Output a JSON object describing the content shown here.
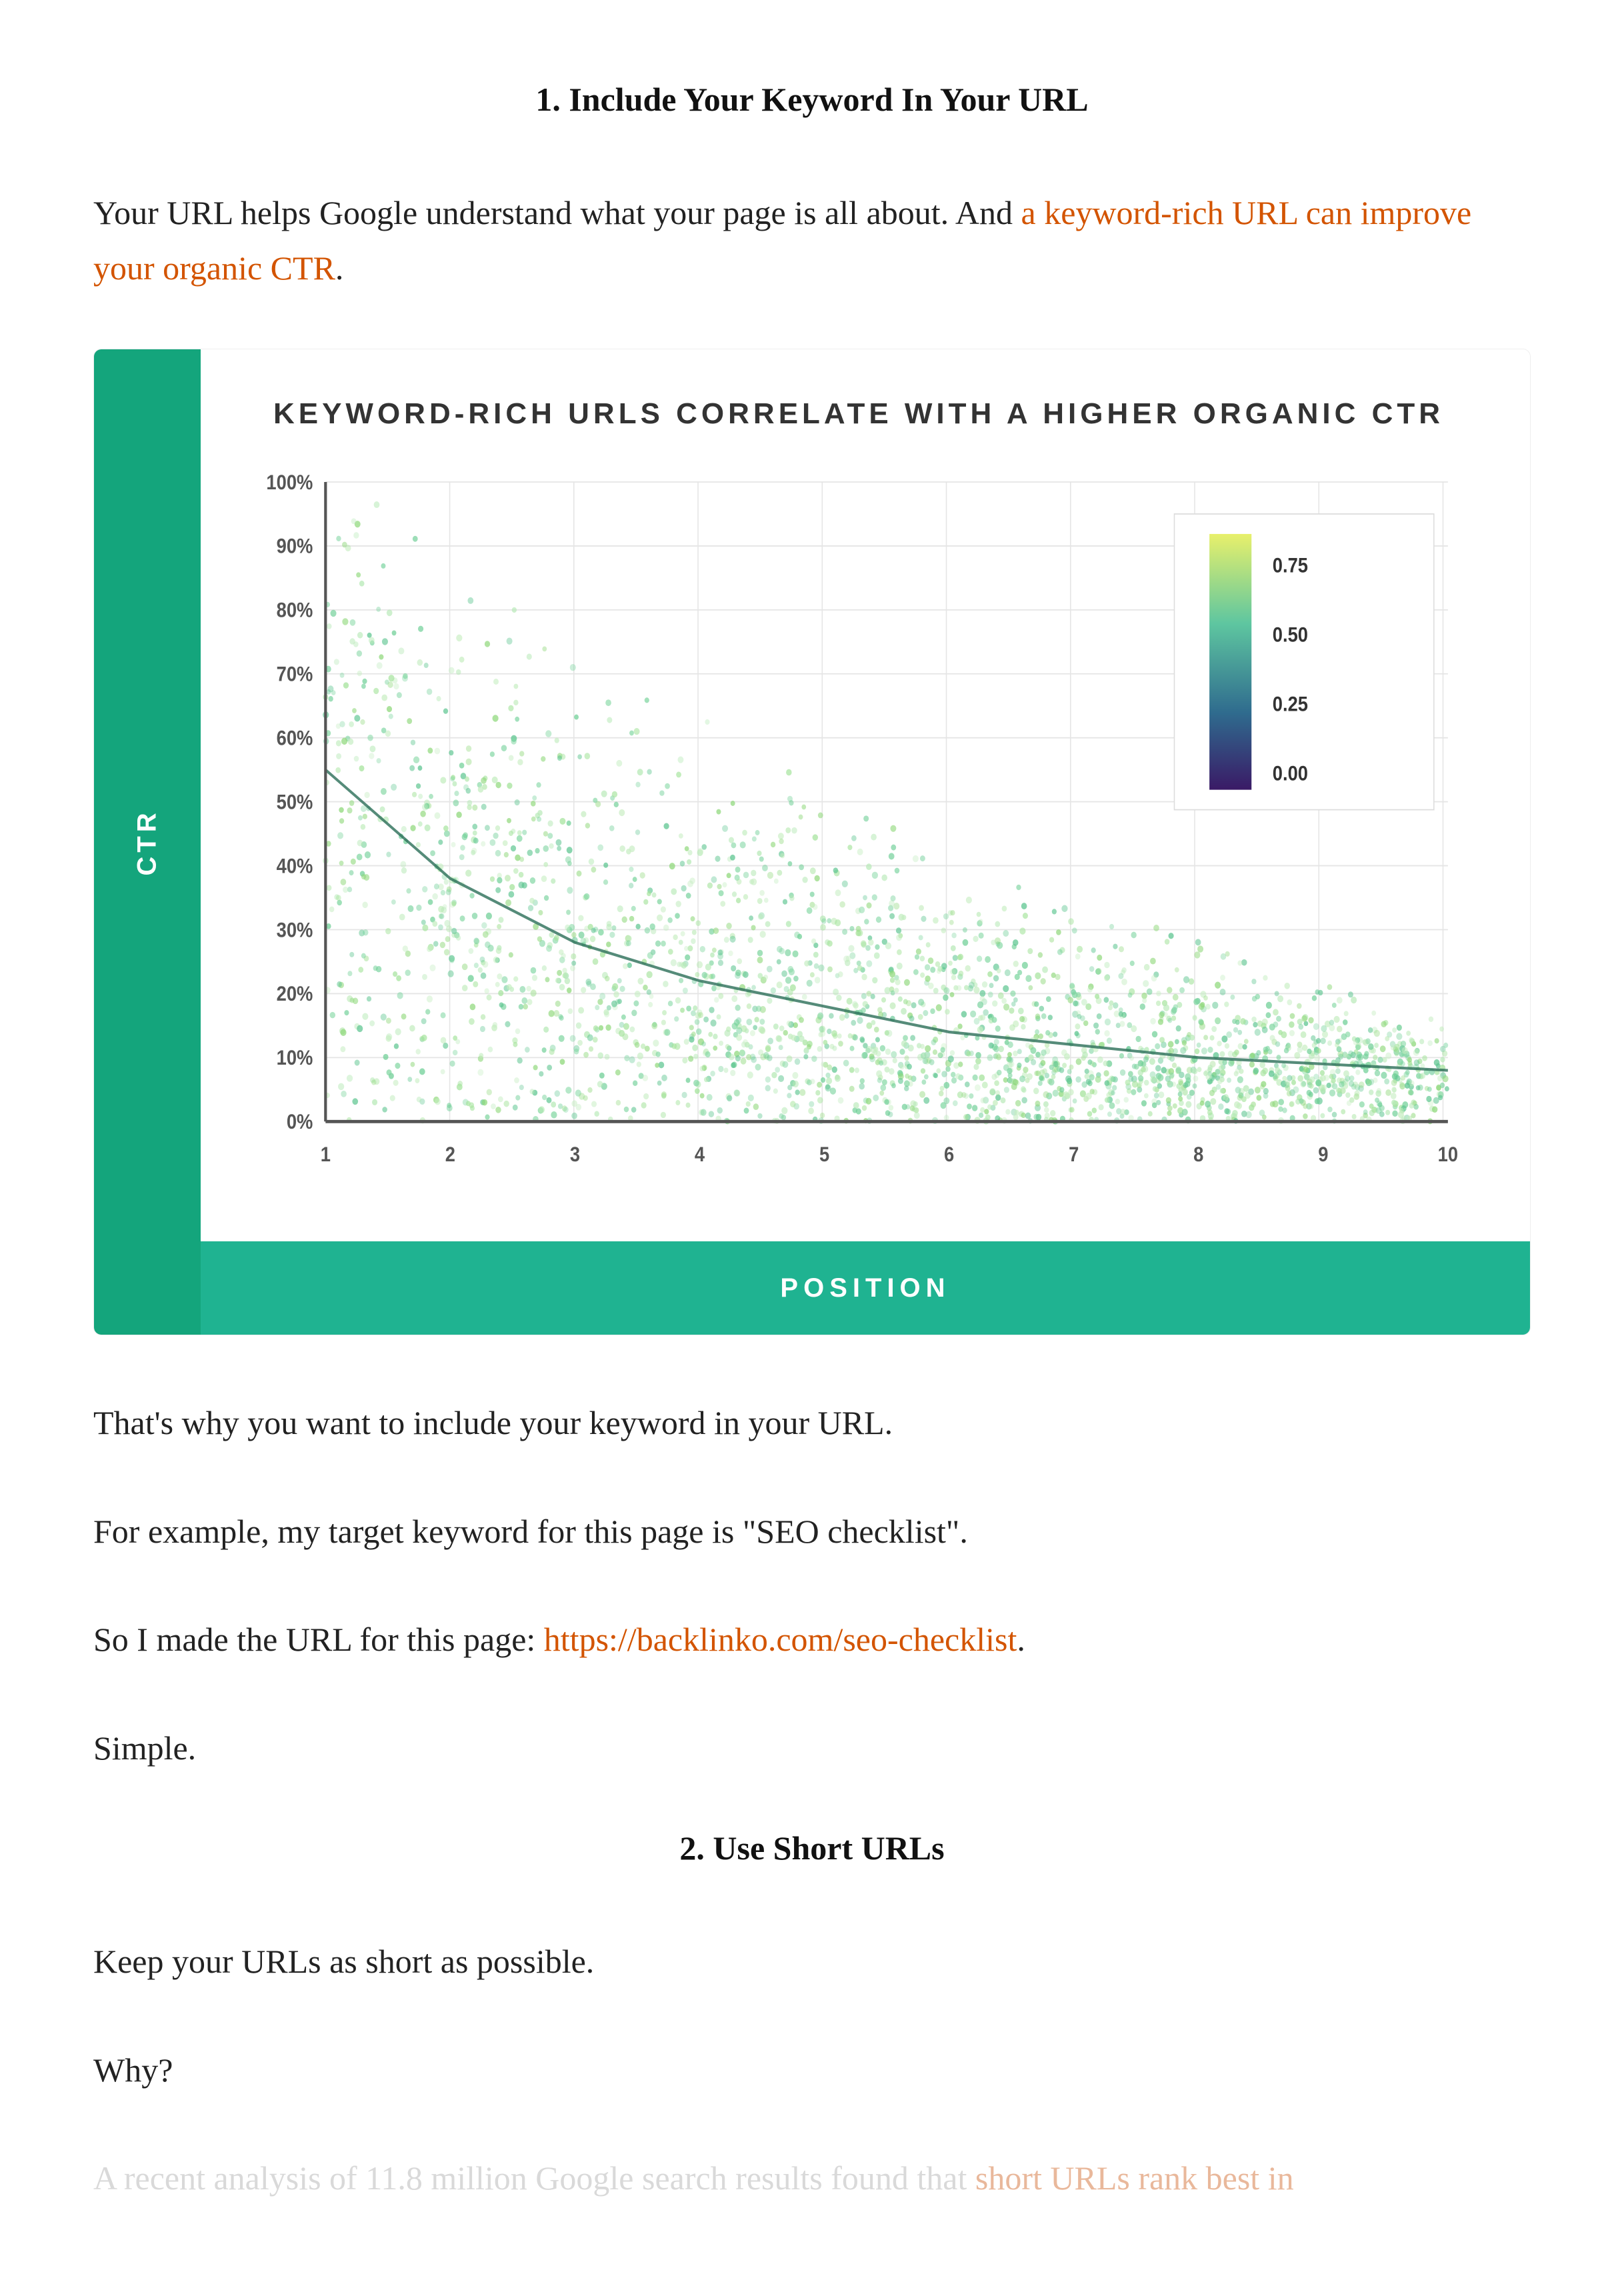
{
  "section1": {
    "heading": "1. Include Your Keyword In Your URL",
    "para1_a": "Your URL helps Google understand what your page is all about. And ",
    "para1_link": "a keyword-rich URL can improve your organic CTR",
    "para1_b": ".",
    "para2": "That's why you want to include your keyword in your URL.",
    "para3": "For example, my target keyword for this page is \"SEO checklist\".",
    "para4_a": "So I made the URL for this page: ",
    "para4_link": "https://backlinko.com/seo-checklist",
    "para4_b": ".",
    "para5": "Simple."
  },
  "section2": {
    "heading": "2. Use Short URLs",
    "para1": "Keep your URLs as short as possible.",
    "para2": "Why?",
    "para3_a": "A recent analysis of 11.8 million Google search results found that ",
    "para3_link": "short URLs rank best in"
  },
  "chart_data": {
    "type": "scatter",
    "title": "KEYWORD-RICH URLS CORRELATE WITH A HIGHER ORGANIC CTR",
    "xlabel": "POSITION",
    "ylabel": "CTR",
    "xlim": [
      1,
      10
    ],
    "ylim": [
      0,
      100
    ],
    "x_ticks": [
      1,
      2,
      3,
      4,
      5,
      6,
      7,
      8,
      9,
      10
    ],
    "y_ticks": [
      "0%",
      "10%",
      "20%",
      "30%",
      "40%",
      "50%",
      "60%",
      "70%",
      "80%",
      "90%",
      "100%"
    ],
    "legend_ticks": [
      "0.75",
      "0.50",
      "0.25",
      "0.00"
    ],
    "legend_gradient": [
      "#e8f06b",
      "#5ec6a0",
      "#2f6b8e",
      "#3a1a66"
    ],
    "trend_line": [
      {
        "x": 1,
        "y": 55
      },
      {
        "x": 2,
        "y": 38
      },
      {
        "x": 3,
        "y": 28
      },
      {
        "x": 4,
        "y": 22
      },
      {
        "x": 5,
        "y": 18
      },
      {
        "x": 6,
        "y": 14
      },
      {
        "x": 7,
        "y": 12
      },
      {
        "x": 8,
        "y": 10
      },
      {
        "x": 9,
        "y": 9
      },
      {
        "x": 10,
        "y": 8
      }
    ],
    "scatter_note": "Dense scatter of green points, density highest along the trend line; vertical spread from ~0% up to ~90% at position 1, narrowing to ~0-25% by position 10."
  }
}
